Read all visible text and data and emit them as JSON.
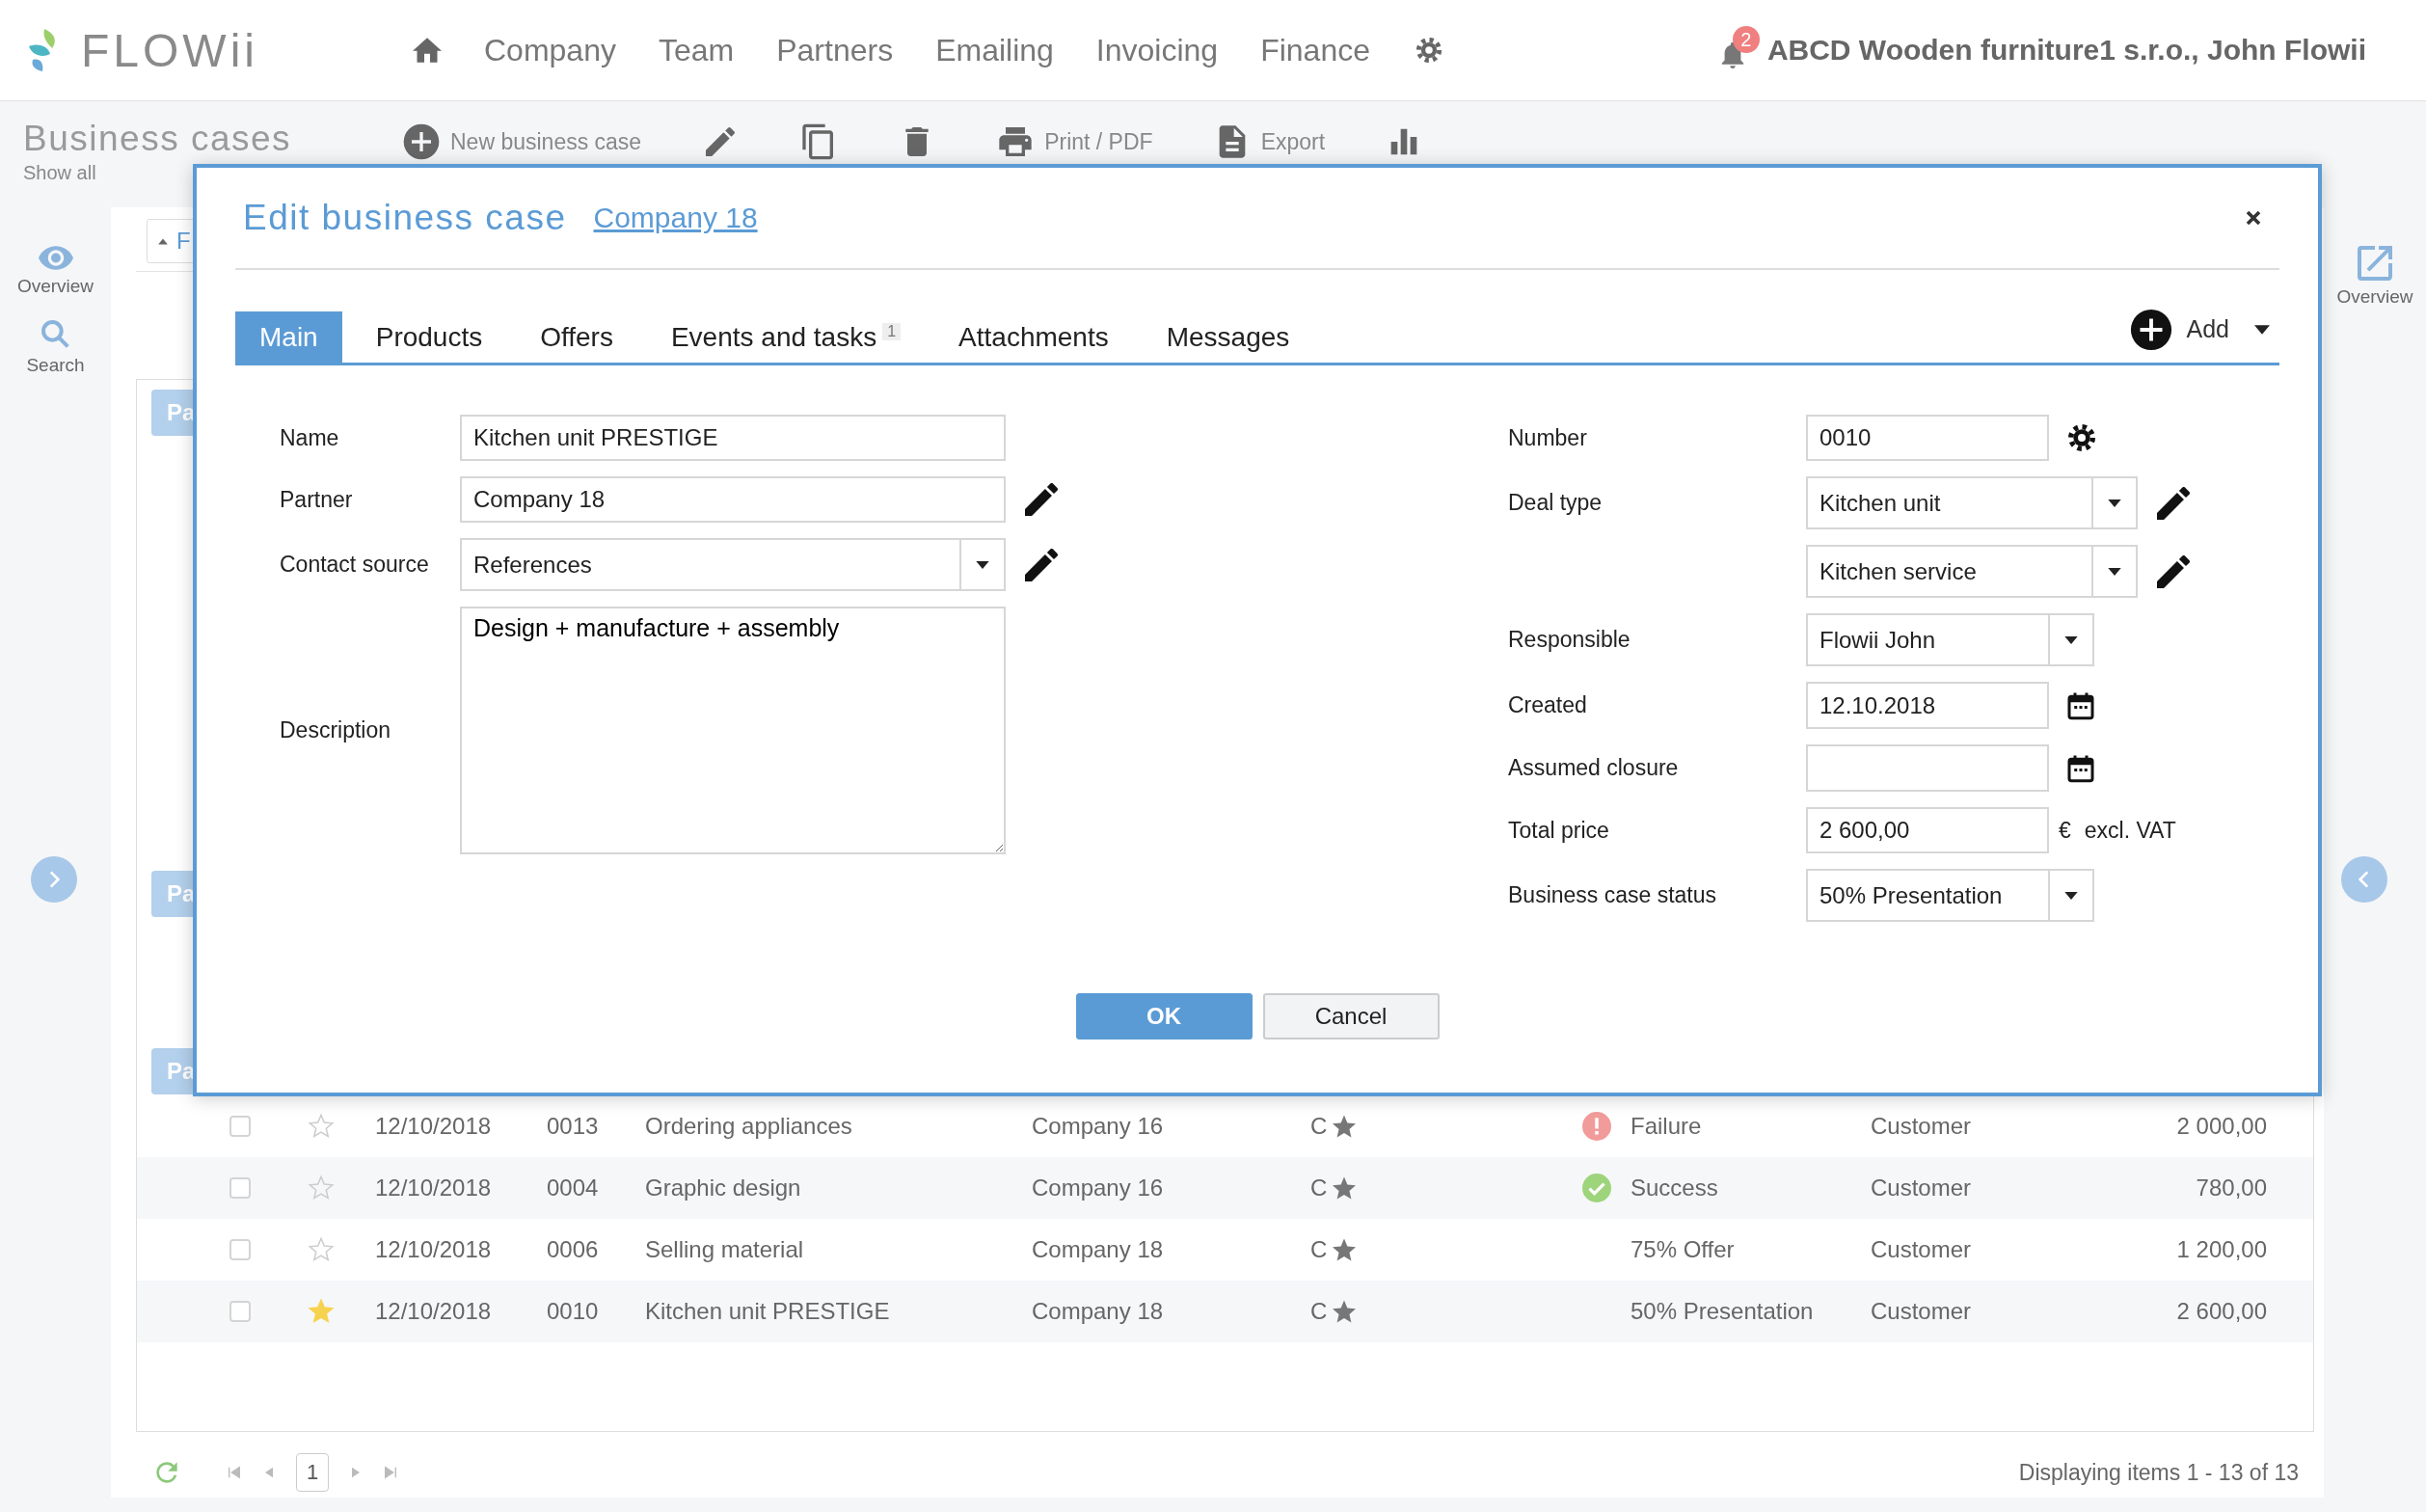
{
  "topbar": {
    "logo": "FLOWii",
    "nav": [
      "Company",
      "Team",
      "Partners",
      "Emailing",
      "Invoicing",
      "Finance"
    ],
    "notifications": "2",
    "account": "ABCD Wooden furniture1 s.r.o., John Flowii"
  },
  "page": {
    "title": "Business cases",
    "subtitle": "Show all"
  },
  "toolbar": [
    {
      "kind": "new",
      "label": "New business case"
    },
    {
      "kind": "edit"
    },
    {
      "kind": "copy"
    },
    {
      "kind": "delete"
    },
    {
      "kind": "print",
      "label": "Print / PDF"
    },
    {
      "kind": "export",
      "label": "Export"
    },
    {
      "kind": "chart"
    }
  ],
  "left_sidebar": [
    {
      "kind": "overview",
      "label": "Overview"
    },
    {
      "kind": "search",
      "label": "Search"
    }
  ],
  "right_sidebar": [
    {
      "kind": "overview",
      "label": "Overview"
    }
  ],
  "filter_button": "F",
  "group_chips": [
    "Pa",
    "Pa",
    "Pa"
  ],
  "rows": [
    {
      "checked": false,
      "favorite": false,
      "date": "12/10/2018",
      "number": "0013",
      "name": "Ordering appliances",
      "company": "Company 16",
      "rating": "C",
      "status_icon": {
        "kind": "failure"
      },
      "status": "Failure",
      "type": "Customer",
      "amount": "2 000,00"
    },
    {
      "checked": false,
      "favorite": false,
      "date": "12/10/2018",
      "number": "0004",
      "name": "Graphic design",
      "company": "Company 16",
      "rating": "C",
      "status_icon": {
        "kind": "success"
      },
      "status": "Success",
      "type": "Customer",
      "amount": "780,00"
    },
    {
      "checked": false,
      "favorite": false,
      "date": "12/10/2018",
      "number": "0006",
      "name": "Selling material",
      "company": "Company 18",
      "rating": "C",
      "status": "75% Offer",
      "type": "Customer",
      "amount": "1 200,00"
    },
    {
      "checked": false,
      "favorite": true,
      "date": "12/10/2018",
      "number": "0010",
      "name": "Kitchen unit PRESTIGE",
      "company": "Company 18",
      "rating": "C",
      "status": "50% Presentation",
      "type": "Customer",
      "amount": "2 600,00"
    }
  ],
  "pager": {
    "page": "1",
    "summary": "Displaying items 1 - 13 of 13"
  },
  "dialog": {
    "title": "Edit business case",
    "link": "Company 18",
    "tabs": [
      {
        "label": "Main",
        "selected": true
      },
      {
        "label": "Products",
        "selected": false
      },
      {
        "label": "Offers",
        "selected": false
      },
      {
        "label": "Events and tasks",
        "selected": false,
        "badge": "1"
      },
      {
        "label": "Attachments",
        "selected": false
      },
      {
        "label": "Messages",
        "selected": false
      }
    ],
    "add": "Add",
    "left_fields": [
      {
        "kind": "text",
        "label": "Name",
        "value": "Kitchen unit PRESTIGE"
      },
      {
        "kind": "text",
        "label": "Partner",
        "value": "Company 18",
        "action": {
          "kind": "edit"
        }
      },
      {
        "kind": "select",
        "label": "Contact source",
        "value": "References",
        "action": {
          "kind": "edit"
        }
      },
      {
        "kind": "textarea",
        "label": "Description",
        "value": "Design + manufacture + assembly"
      }
    ],
    "right_fields": [
      {
        "kind": "text",
        "label": "Number",
        "value": "0010",
        "action": {
          "kind": "settings"
        }
      },
      {
        "kind": "select",
        "label": "Deal type",
        "value": "Kitchen unit",
        "action": {
          "kind": "edit"
        }
      },
      {
        "kind": "select",
        "value": "Kitchen service",
        "action": {
          "kind": "edit"
        }
      },
      {
        "kind": "select",
        "label": "Responsible",
        "value": "Flowii John"
      },
      {
        "kind": "date",
        "label": "Created",
        "value": "12.10.2018"
      },
      {
        "kind": "date",
        "label": "Assumed closure"
      },
      {
        "kind": "text",
        "label": "Total price",
        "value": "2 600,00",
        "currency": "€",
        "note": "excl. VAT"
      },
      {
        "kind": "select",
        "label": "Business case status",
        "value": "50% Presentation"
      }
    ],
    "buttons": [
      {
        "kind": "primary",
        "label": "OK"
      },
      {
        "kind": "secondary",
        "label": "Cancel"
      }
    ]
  }
}
